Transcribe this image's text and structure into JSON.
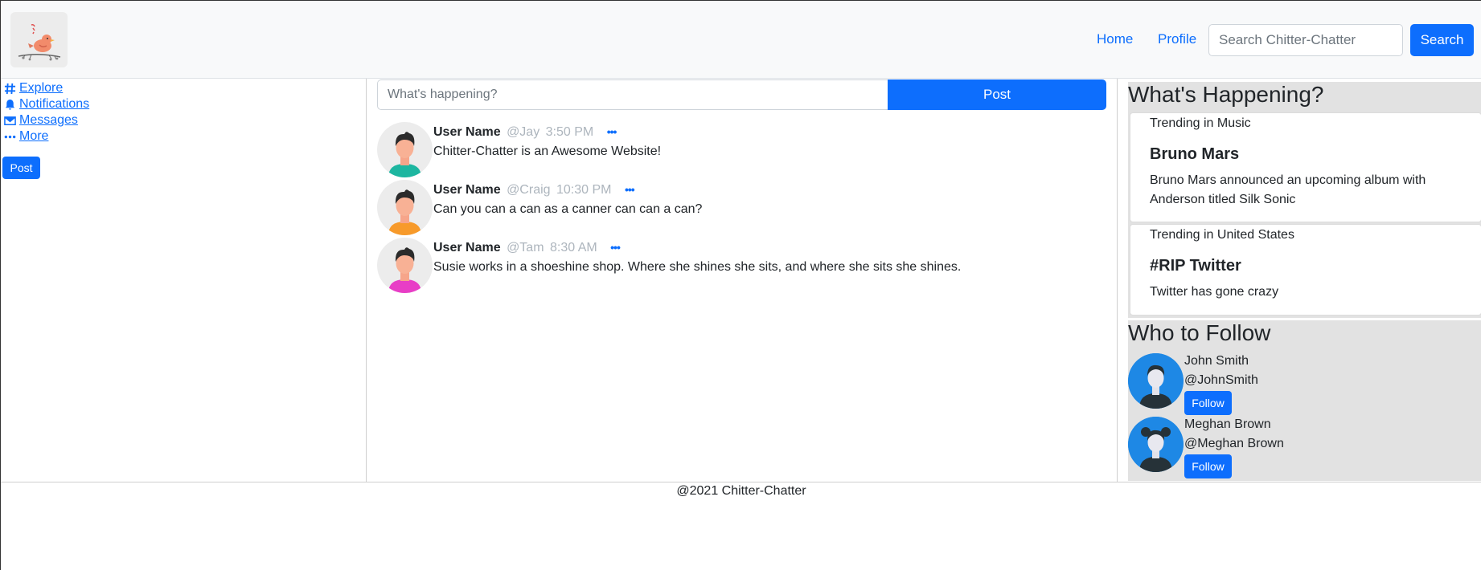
{
  "navbar": {
    "home": "Home",
    "profile": "Profile",
    "search_placeholder": "Search Chitter-Chatter",
    "search_button": "Search"
  },
  "sidebar": {
    "items": [
      {
        "label": " Explore",
        "icon": "hashtag-icon"
      },
      {
        "label": " Notifications",
        "icon": "bell-icon"
      },
      {
        "label": " Messages",
        "icon": "envelope-icon"
      },
      {
        "label": " More",
        "icon": "ellipsis-icon"
      }
    ],
    "post_button": "Post"
  },
  "compose": {
    "placeholder": "What's happening?",
    "post_button": "Post"
  },
  "tweets": [
    {
      "user": "User Name",
      "handle": "@Jay",
      "time": "3:50 PM",
      "more": "•••",
      "body": "Chitter-Chatter is an Awesome Website!",
      "shirt_color": "#1db6a0"
    },
    {
      "user": "User Name",
      "handle": "@Craig",
      "time": "10:30 PM",
      "more": "•••",
      "body": "Can you can a can as a canner can can a can?",
      "shirt_color": "#f79a2a"
    },
    {
      "user": "User Name",
      "handle": "@Tam",
      "time": "8:30 AM",
      "more": "•••",
      "body": "Susie works in a shoeshine shop. Where she shines she sits, and where she sits she shines.",
      "shirt_color": "#e83ec6"
    }
  ],
  "whats_happening": {
    "title": "What's Happening?",
    "trends": [
      {
        "category": "Trending in Music",
        "name": "Bruno Mars",
        "description": "Bruno Mars announced an upcoming album with Anderson titled Silk Sonic"
      },
      {
        "category": "Trending in United States",
        "name": "#RIP Twitter",
        "description": "Twitter has gone crazy"
      }
    ]
  },
  "who_to_follow": {
    "title": "Who to Follow",
    "users": [
      {
        "name": "John Smith",
        "handle": "@JohnSmith",
        "button": "Follow"
      },
      {
        "name": "Meghan Brown",
        "handle": "@Meghan Brown",
        "button": "Follow"
      }
    ]
  },
  "footer": {
    "text": "@2021 Chitter-Chatter"
  },
  "colors": {
    "accent": "#0d6efd",
    "panel_gray": "#e2e2e2",
    "navbar_bg": "#f8f9fa"
  }
}
